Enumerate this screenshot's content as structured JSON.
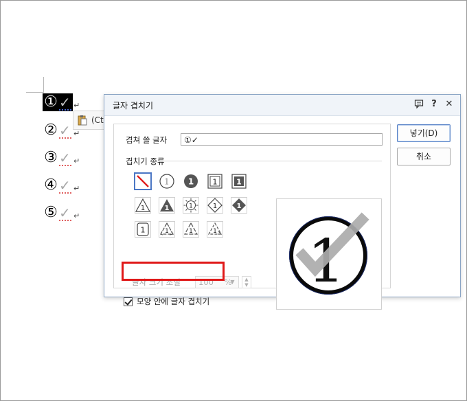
{
  "document": {
    "lines": [
      {
        "number": "①",
        "mark": "✓",
        "return": "↵",
        "selected": true
      },
      {
        "number": "②",
        "mark": "✓",
        "return": "↵",
        "selected": false
      },
      {
        "number": "③",
        "mark": "✓",
        "return": "↵",
        "selected": false
      },
      {
        "number": "④",
        "mark": "✓",
        "return": "↵",
        "selected": false
      },
      {
        "number": "⑤",
        "mark": "✓",
        "return": "↵",
        "selected": false
      }
    ],
    "paste_tag": "(Ct"
  },
  "dialog": {
    "title": "글자 겹치기",
    "icons": {
      "help_glyph": "?",
      "close_glyph": "✕"
    },
    "overlap_label": "겹쳐 쓸 글자",
    "overlap_value": "①✓",
    "type_group_label": "겹치기 종류",
    "types": [
      {
        "name": "none",
        "glyph": ""
      },
      {
        "name": "circle-outline",
        "glyph": "1"
      },
      {
        "name": "circle-filled",
        "glyph": "1"
      },
      {
        "name": "square-outline",
        "glyph": "1"
      },
      {
        "name": "square-filled",
        "glyph": "1"
      },
      {
        "name": "triangle-outline",
        "glyph": "1"
      },
      {
        "name": "triangle-filled",
        "glyph": "1"
      },
      {
        "name": "sun",
        "glyph": "1"
      },
      {
        "name": "diamond-outline",
        "glyph": "1"
      },
      {
        "name": "diamond-filled",
        "glyph": "1"
      },
      {
        "name": "rounded-square",
        "glyph": "1"
      },
      {
        "name": "recycle-1",
        "glyph": "1"
      },
      {
        "name": "recycle-2",
        "glyph": "1"
      },
      {
        "name": "recycle-3",
        "glyph": "1"
      }
    ],
    "selected_type": "none",
    "size_label": "글자 크기 조절",
    "size_value": "100",
    "size_unit": "%",
    "checkbox_label": "모양 안에 글자 겹치기",
    "checkbox_checked": true,
    "preview": {
      "number": "1",
      "mark": "✓"
    },
    "buttons": {
      "insert": "넣기(D)",
      "cancel": "취소"
    },
    "colors": {
      "highlight": "#e01818",
      "accent": "#4a76c4"
    }
  }
}
